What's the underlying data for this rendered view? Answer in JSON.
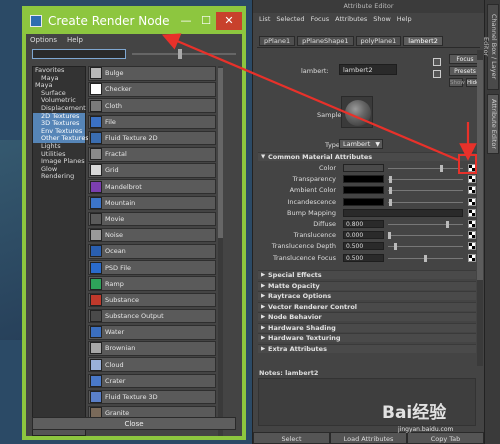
{
  "render_node": {
    "title": "Create Render Node",
    "menu": [
      "Options",
      "Help"
    ],
    "tree": [
      {
        "label": "Favorites",
        "indent": false,
        "selected": false
      },
      {
        "label": "Maya",
        "indent": true,
        "selected": false
      },
      {
        "label": "Maya",
        "indent": false,
        "selected": false
      },
      {
        "label": "Surface",
        "indent": true,
        "selected": false
      },
      {
        "label": "Volumetric",
        "indent": true,
        "selected": false
      },
      {
        "label": "Displacement",
        "indent": true,
        "selected": false
      },
      {
        "label": "2D Textures",
        "indent": true,
        "selected": true
      },
      {
        "label": "3D Textures",
        "indent": true,
        "selected": true
      },
      {
        "label": "Env Textures",
        "indent": true,
        "selected": true
      },
      {
        "label": "Other Textures",
        "indent": true,
        "selected": true
      },
      {
        "label": "Lights",
        "indent": true,
        "selected": false
      },
      {
        "label": "Utilities",
        "indent": true,
        "selected": false
      },
      {
        "label": "Image Planes",
        "indent": true,
        "selected": false
      },
      {
        "label": "Glow",
        "indent": true,
        "selected": false
      },
      {
        "label": "Rendering",
        "indent": true,
        "selected": false
      }
    ],
    "nodes": [
      {
        "label": "Bulge",
        "color": "#b9b9b9"
      },
      {
        "label": "Checker",
        "color": "#ffffff"
      },
      {
        "label": "Cloth",
        "color": "#7a7a7a"
      },
      {
        "label": "File",
        "color": "#3b71c4"
      },
      {
        "label": "Fluid Texture 2D",
        "color": "#3a6db0"
      },
      {
        "label": "Fractal",
        "color": "#8a8a8a"
      },
      {
        "label": "Grid",
        "color": "#d8d8d8"
      },
      {
        "label": "Mandelbrot",
        "color": "#7b3fb0"
      },
      {
        "label": "Mountain",
        "color": "#3c74c8"
      },
      {
        "label": "Movie",
        "color": "#5a5a5a"
      },
      {
        "label": "Noise",
        "color": "#9a9a9a"
      },
      {
        "label": "Ocean",
        "color": "#2a5fb0"
      },
      {
        "label": "PSD File",
        "color": "#2a6bcc"
      },
      {
        "label": "Ramp",
        "color": "#2ea35a"
      },
      {
        "label": "Substance",
        "color": "#c0392b"
      },
      {
        "label": "Substance Output",
        "color": "#4a4a4a"
      },
      {
        "label": "Water",
        "color": "#3b6fc0"
      },
      {
        "label": "Brownian",
        "color": "#a8a8a8"
      },
      {
        "label": "Cloud",
        "color": "#9ab0d8"
      },
      {
        "label": "Crater",
        "color": "#4a79c8"
      },
      {
        "label": "Fluid Texture 3D",
        "color": "#5a7fc8"
      },
      {
        "label": "Granite",
        "color": "#7a6a5a"
      }
    ],
    "close_label": "Close"
  },
  "attr_editor": {
    "title": "Attribute Editor",
    "menu": [
      "List",
      "Selected",
      "Focus",
      "Attributes",
      "Show",
      "Help"
    ],
    "tabs": [
      {
        "label": "pPlane1",
        "active": false
      },
      {
        "label": "pPlaneShape1",
        "active": false
      },
      {
        "label": "polyPlane1",
        "active": false
      },
      {
        "label": "lambert2",
        "active": true
      }
    ],
    "node_label": "lambert:",
    "node_value": "lambert2",
    "focus_label": "Focus",
    "presets_label": "Presets",
    "show_label": "Show",
    "hide_label": "Hide",
    "sample_label": "Sample",
    "type_label": "Type",
    "type_value": "Lambert",
    "common_section": "Common Material Attributes",
    "attributes": [
      {
        "label": "Color",
        "kind": "color",
        "color": "#4a4a4a",
        "knob": 0.72
      },
      {
        "label": "Transparency",
        "kind": "color",
        "color": "#000000",
        "knob": 0.02
      },
      {
        "label": "Ambient Color",
        "kind": "color",
        "color": "#000000",
        "knob": 0.02
      },
      {
        "label": "Incandescence",
        "kind": "color",
        "color": "#000000",
        "knob": 0.02
      },
      {
        "label": "Bump Mapping",
        "kind": "bar"
      },
      {
        "label": "Diffuse",
        "kind": "num",
        "value": "0.800",
        "knob": 0.8
      },
      {
        "label": "Translucence",
        "kind": "num",
        "value": "0.000",
        "knob": 0.0
      },
      {
        "label": "Translucence Depth",
        "kind": "num",
        "value": "0.500",
        "knob": 0.08
      },
      {
        "label": "Translucence Focus",
        "kind": "num",
        "value": "0.500",
        "knob": 0.5
      }
    ],
    "sections": [
      "Special Effects",
      "Matte Opacity",
      "Raytrace Options",
      "Vector Renderer Control",
      "Node Behavior",
      "Hardware Shading",
      "Hardware Texturing",
      "Extra Attributes"
    ],
    "notes_label": "Notes:  lambert2",
    "bottom_buttons": [
      "Select",
      "Load Attributes",
      "Copy Tab"
    ]
  },
  "dock_tabs": [
    "Channel Box / Layer Editor",
    "Attribute Editor"
  ],
  "watermark": "Bai经验",
  "watermark_sub": "jingyan.baidu.com",
  "colors": {
    "window_border": "#8dc63f",
    "highlight": "#e8312a",
    "selection": "#5685b7"
  }
}
